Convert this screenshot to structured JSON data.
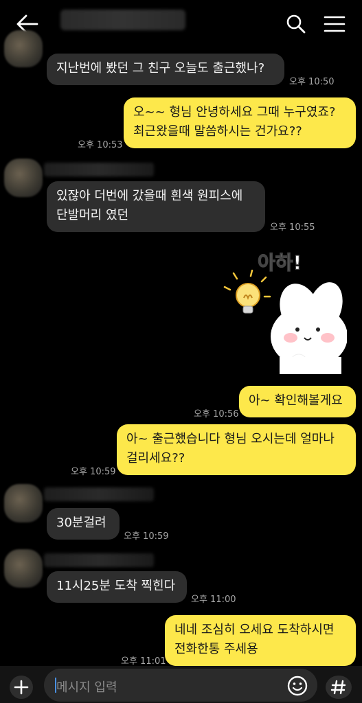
{
  "messages": [
    {
      "from": "them",
      "text": "지난번에 봤던 그 친구 오늘도 출근했나?",
      "time": "오후 10:50"
    },
    {
      "from": "me",
      "lines": [
        "오~~ 형님 안녕하세요 그때 누구였죠?",
        "최근왔을때 말씀하시는 건가요??"
      ],
      "time": "오후 10:53"
    },
    {
      "from": "them",
      "lines": [
        "있잖아 더번에 갔을때 흰색 원피스에",
        "단발머리 였던"
      ],
      "time": "오후 10:55"
    },
    {
      "from": "me",
      "sticker": "bunny-lightbulb",
      "sticker_text": "아하!"
    },
    {
      "from": "me",
      "text": "아~ 확인해볼게요",
      "time": "오후 10:56"
    },
    {
      "from": "me",
      "lines": [
        "아~ 출근했습니다 형님 오시는데 얼마나",
        "걸리세요??"
      ],
      "time": "오후 10:59"
    },
    {
      "from": "them",
      "text": "30분걸려",
      "time": "오후 10:59"
    },
    {
      "from": "them",
      "text": "11시25분 도착 찍힌다",
      "time": "오후 11:00"
    },
    {
      "from": "me",
      "lines": [
        "네네 조심히 오세요 도착하시면",
        "전화한통 주세용"
      ],
      "time": "오후 11:01"
    }
  ],
  "input": {
    "placeholder": "메시지 입력"
  },
  "colors": {
    "out_bubble": "#fde84b",
    "in_bubble": "#2e2e2e",
    "background": "#000000"
  },
  "icons": {
    "back": "arrow-left",
    "search": "magnifier",
    "menu": "hamburger",
    "plus": "plus",
    "emoji": "smiley",
    "hash": "hash"
  }
}
